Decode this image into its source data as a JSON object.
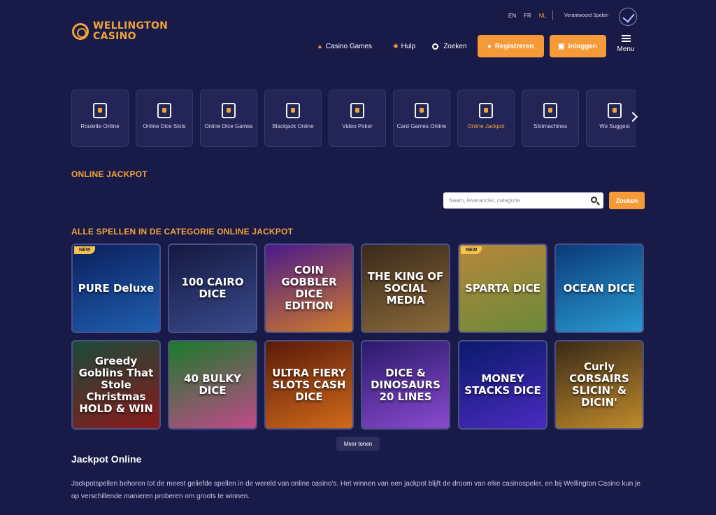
{
  "brand": {
    "line1": "WELLINGTON",
    "line2": "CASINO"
  },
  "languages": [
    {
      "code": "EN",
      "active": false
    },
    {
      "code": "FR",
      "active": false
    },
    {
      "code": "NL",
      "active": true
    }
  ],
  "responsible": "Verantwoord Spelen",
  "nav": {
    "casino_games": "Casino Games",
    "help": "Hulp",
    "search": "Zoeken",
    "register": "Registreren",
    "login": "Inloggen",
    "menu": "Menu"
  },
  "categories": [
    {
      "label": "Roulette Online",
      "active": false
    },
    {
      "label": "Online Dice Slots",
      "active": false
    },
    {
      "label": "Online Dice Games",
      "active": false
    },
    {
      "label": "Blackjack Online",
      "active": false
    },
    {
      "label": "Video Poker",
      "active": false
    },
    {
      "label": "Card Games Online",
      "active": false
    },
    {
      "label": "Online Jackpot",
      "active": true
    },
    {
      "label": "Slotmachines",
      "active": false
    },
    {
      "label": "We Suggest",
      "active": false
    }
  ],
  "page_title": "ONLINE JACKPOT",
  "search": {
    "placeholder": "Naam, leverancier, categorie",
    "button": "Zoeken"
  },
  "grid_title": "ALLE SPELLEN IN DE CATEGORIE ONLINE JACKPOT",
  "new_label": "NEW",
  "games": [
    {
      "name": "PURE Deluxe",
      "new": true,
      "colors": [
        "#0b1f5c",
        "#1f5fb0"
      ]
    },
    {
      "name": "100 CAIRO DICE",
      "new": false,
      "colors": [
        "#141940",
        "#3a4a8c"
      ]
    },
    {
      "name": "COIN GOBBLER DICE EDITION",
      "new": false,
      "colors": [
        "#4a1a8a",
        "#d07a2a"
      ]
    },
    {
      "name": "THE KING OF SOCIAL MEDIA",
      "new": false,
      "colors": [
        "#3a2a1a",
        "#8a6a3a"
      ]
    },
    {
      "name": "SPARTA DICE",
      "new": true,
      "colors": [
        "#b8863a",
        "#6a8a3a"
      ]
    },
    {
      "name": "OCEAN DICE",
      "new": false,
      "colors": [
        "#0a3a7a",
        "#2a9ad0"
      ]
    },
    {
      "name": "Greedy Goblins That Stole Christmas HOLD & WIN",
      "new": false,
      "colors": [
        "#1a4a3a",
        "#8a1a1a"
      ]
    },
    {
      "name": "40 BULKY DICE",
      "new": false,
      "colors": [
        "#1a7a2a",
        "#c04a8a"
      ]
    },
    {
      "name": "ULTRA FIERY SLOTS CASH DICE",
      "new": false,
      "colors": [
        "#5a1a0a",
        "#d06a1a"
      ]
    },
    {
      "name": "DICE & DINOSAURS 20 LINES",
      "new": false,
      "colors": [
        "#2a1a6a",
        "#8a4ad0"
      ]
    },
    {
      "name": "MONEY STACKS DICE",
      "new": false,
      "colors": [
        "#0a1a6a",
        "#4a2ac0"
      ]
    },
    {
      "name": "Curly CORSAIRS SLICIN' & DICIN'",
      "new": false,
      "colors": [
        "#3a2a1a",
        "#c08a2a"
      ]
    }
  ],
  "more_button": "Meer tonen",
  "content_heading": "Jackpot Online",
  "content_text": "Jackpotspellen behoren tot de meest geliefde spellen in de wereld van online casino's. Het winnen van een jackpot blijft de droom van elke casinospeler, en bij Wellington Casino kun je op verschillende manieren proberen om groots te winnen.",
  "colors": {
    "accent": "#f59a36",
    "background": "#181a48",
    "card": "#222556"
  }
}
